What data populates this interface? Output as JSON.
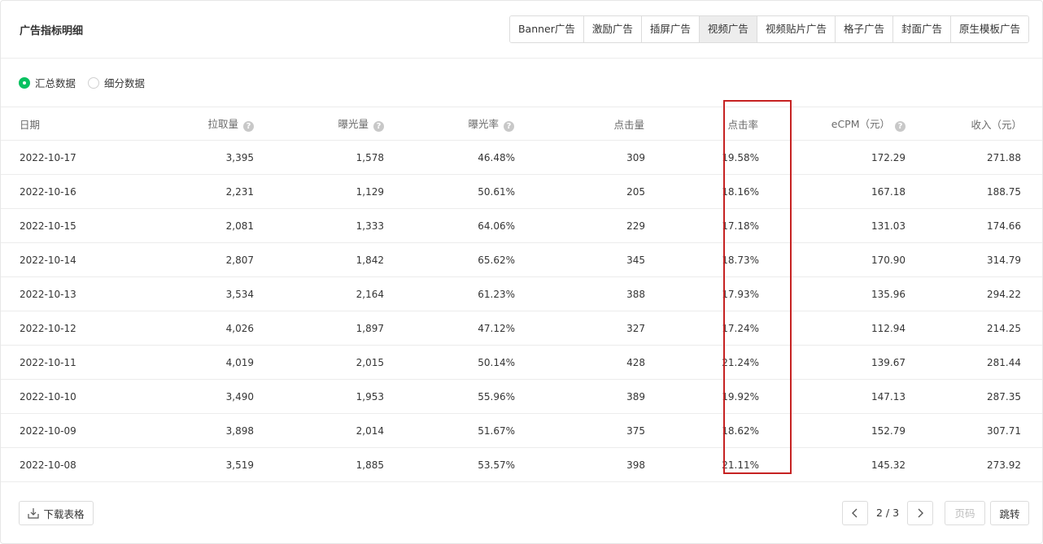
{
  "panel": {
    "title": "广告指标明细"
  },
  "tabs": [
    {
      "label": "Banner广告",
      "active": false
    },
    {
      "label": "激励广告",
      "active": false
    },
    {
      "label": "插屏广告",
      "active": false
    },
    {
      "label": "视频广告",
      "active": true
    },
    {
      "label": "视频贴片广告",
      "active": false
    },
    {
      "label": "格子广告",
      "active": false
    },
    {
      "label": "封面广告",
      "active": false
    },
    {
      "label": "原生模板广告",
      "active": false
    }
  ],
  "view_mode": {
    "options": [
      {
        "label": "汇总数据",
        "selected": true
      },
      {
        "label": "细分数据",
        "selected": false
      }
    ]
  },
  "table": {
    "columns": [
      "日期",
      "拉取量",
      "曝光量",
      "曝光率",
      "点击量",
      "点击率",
      "eCPM（元）",
      "收入（元）"
    ],
    "help_icon": "?",
    "rows": [
      [
        "2022-10-17",
        "3,395",
        "1,578",
        "46.48%",
        "309",
        "19.58%",
        "172.29",
        "271.88"
      ],
      [
        "2022-10-16",
        "2,231",
        "1,129",
        "50.61%",
        "205",
        "18.16%",
        "167.18",
        "188.75"
      ],
      [
        "2022-10-15",
        "2,081",
        "1,333",
        "64.06%",
        "229",
        "17.18%",
        "131.03",
        "174.66"
      ],
      [
        "2022-10-14",
        "2,807",
        "1,842",
        "65.62%",
        "345",
        "18.73%",
        "170.90",
        "314.79"
      ],
      [
        "2022-10-13",
        "3,534",
        "2,164",
        "61.23%",
        "388",
        "17.93%",
        "135.96",
        "294.22"
      ],
      [
        "2022-10-12",
        "4,026",
        "1,897",
        "47.12%",
        "327",
        "17.24%",
        "112.94",
        "214.25"
      ],
      [
        "2022-10-11",
        "4,019",
        "2,015",
        "50.14%",
        "428",
        "21.24%",
        "139.67",
        "281.44"
      ],
      [
        "2022-10-10",
        "3,490",
        "1,953",
        "55.96%",
        "389",
        "19.92%",
        "147.13",
        "287.35"
      ],
      [
        "2022-10-09",
        "3,898",
        "2,014",
        "51.67%",
        "375",
        "18.62%",
        "152.79",
        "307.71"
      ],
      [
        "2022-10-08",
        "3,519",
        "1,885",
        "53.57%",
        "398",
        "21.11%",
        "145.32",
        "273.92"
      ]
    ]
  },
  "footer": {
    "download_label": "下载表格",
    "page_info": "2 / 3",
    "page_input_placeholder": "页码",
    "jump_label": "跳转"
  },
  "colors": {
    "accent_green": "#07c160",
    "highlight_red": "#c62222"
  }
}
